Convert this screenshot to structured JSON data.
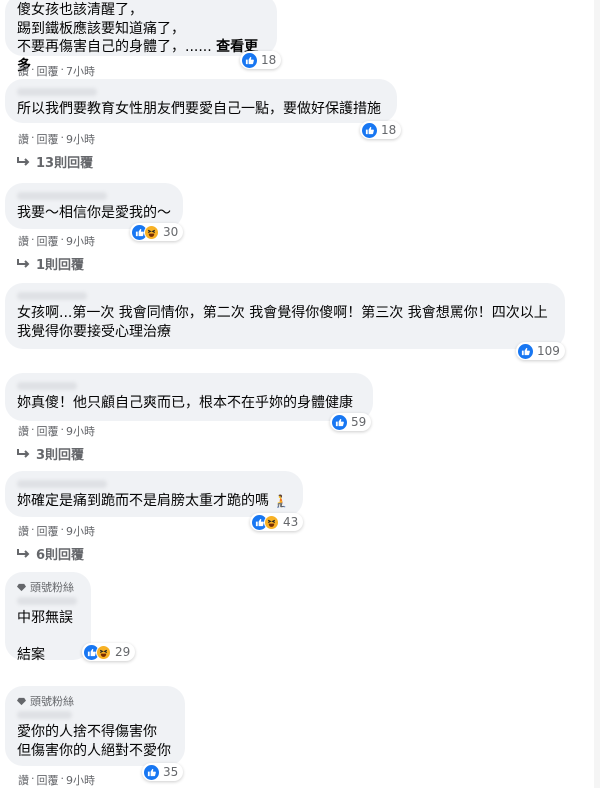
{
  "comments": [
    {
      "lines": [
        "傻女孩也該清醒了，",
        "踢到鐵板應該要知道痛了，",
        "不要再傷害自己的身體了，......"
      ],
      "see_more": "查看更多",
      "reaction_count": "18",
      "actions": {
        "like": "讚",
        "reply": "回覆",
        "time": "7小時"
      }
    },
    {
      "text": "所以我們要教育女性朋友們要愛自己一點，要做好保護措施",
      "reaction_count": "18",
      "actions": {
        "like": "讚",
        "reply": "回覆",
        "time": "9小時"
      },
      "replies": "13則回覆"
    },
    {
      "text": "我要～相信你是愛我的～",
      "reaction_count": "30",
      "actions": {
        "like": "讚",
        "reply": "回覆",
        "time": "9小時"
      },
      "replies": "1則回覆"
    },
    {
      "text": "女孩啊...第一次 我會同情你，第二次 我會覺得你傻啊！第三次 我會想罵你！四次以上 我覺得你要接受心理治療",
      "reaction_count": "109"
    },
    {
      "text": "妳真傻！他只顧自己爽而已，根本不在乎妳的身體健康",
      "reaction_count": "59",
      "actions": {
        "like": "讚",
        "reply": "回覆",
        "time": "9小時"
      },
      "replies": "3則回覆"
    },
    {
      "text": "妳確定是痛到跪而不是肩膀太重才跪的嗎",
      "reaction_count": "43",
      "actions": {
        "like": "讚",
        "reply": "回覆",
        "time": "9小時"
      },
      "replies": "6則回覆"
    },
    {
      "badge": "頭號粉絲",
      "text": "中邪無誤\n\n結案",
      "reaction_count": "29"
    },
    {
      "badge": "頭號粉絲",
      "text": "愛你的人捨不得傷害你\n但傷害你的人絕對不愛你",
      "reaction_count": "35",
      "actions": {
        "like": "讚",
        "reply": "回覆",
        "time": "9小時"
      }
    }
  ],
  "dot": "·",
  "icons": [
    "like-icon",
    "haha-icon",
    "reply-arrow-icon",
    "diamond-icon"
  ],
  "colors": {
    "bubble": "#f0f2f5",
    "like": "#1877f2",
    "haha": "#f7b125",
    "meta": "#65676b"
  }
}
